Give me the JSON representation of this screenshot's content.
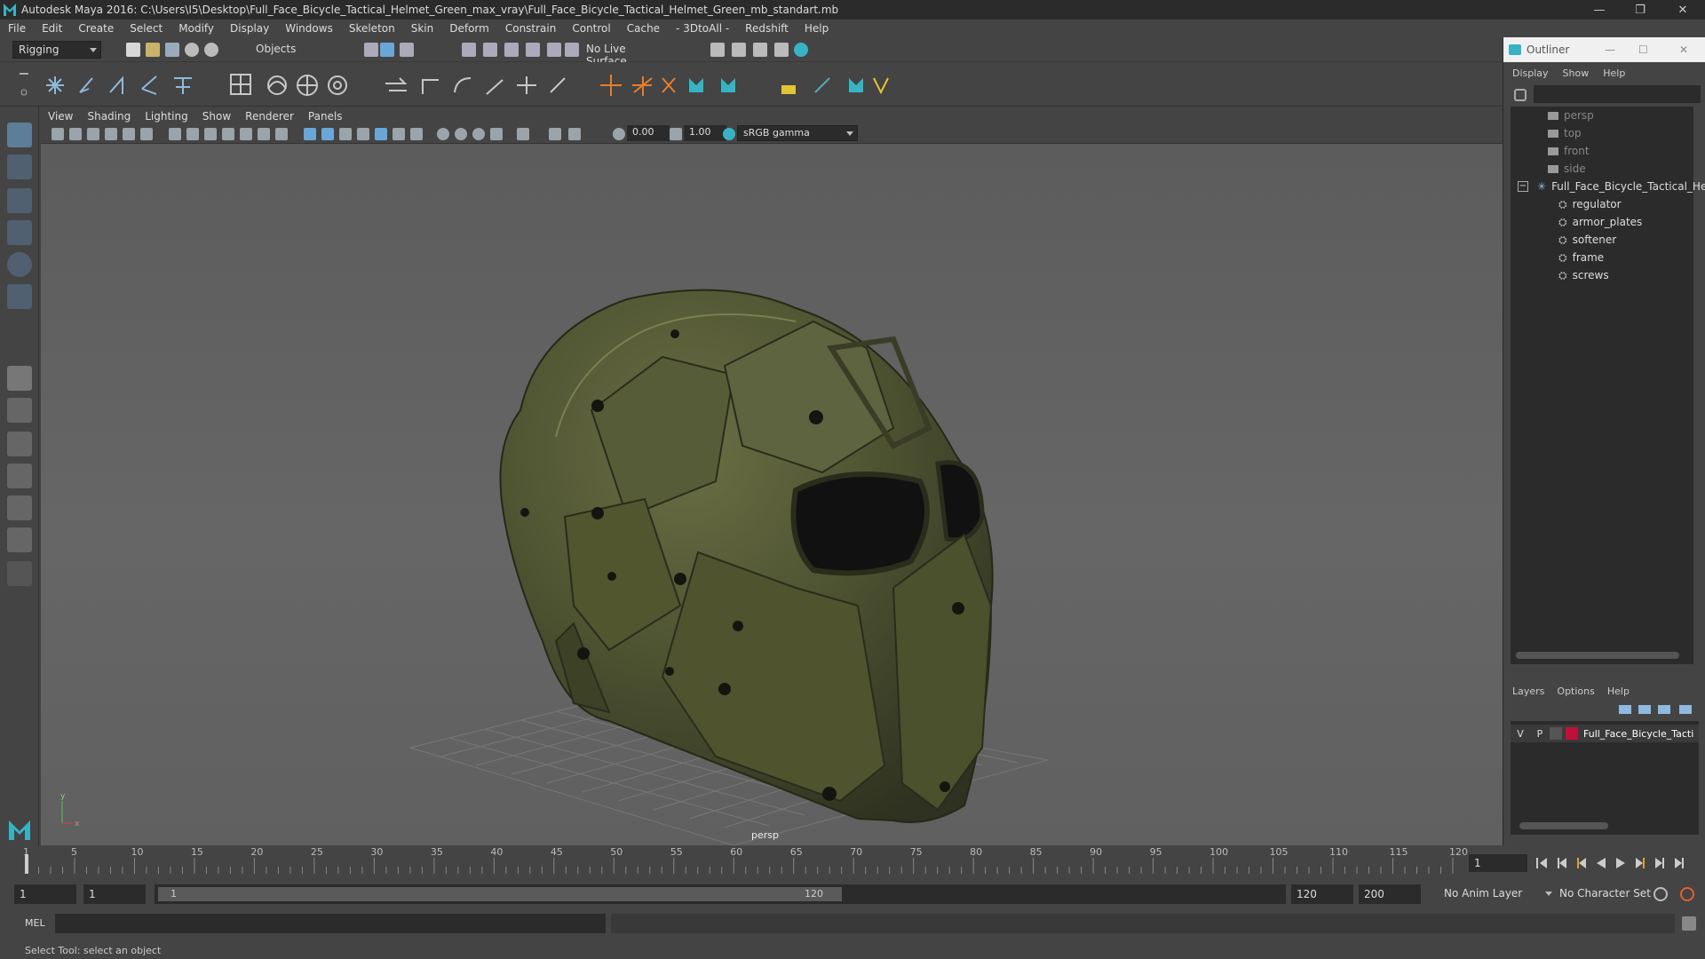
{
  "window": {
    "title": "Autodesk Maya 2016: C:\\Users\\I5\\Desktop\\Full_Face_Bicycle_Tactical_Helmet_Green_max_vray\\Full_Face_Bicycle_Tactical_Helmet_Green_mb_standart.mb",
    "minimize": "—",
    "maximize": "❐",
    "close": "✕"
  },
  "menus": [
    "File",
    "Edit",
    "Create",
    "Select",
    "Modify",
    "Display",
    "Windows",
    "Skeleton",
    "Skin",
    "Deform",
    "Constrain",
    "Control",
    "Cache",
    "- 3DtoAll -",
    "Redshift",
    "Help"
  ],
  "statusline": {
    "menuset": "Rigging",
    "selection_mode": "Objects",
    "live_surface": "No Live Surface"
  },
  "viewport": {
    "menus": [
      "View",
      "Shading",
      "Lighting",
      "Show",
      "Renderer",
      "Panels"
    ],
    "exposure": "0.00",
    "gamma": "1.00",
    "colorspace": "sRGB gamma",
    "camera_label": "persp",
    "axis_y": "y",
    "axis_x": "x"
  },
  "outliner": {
    "title": "Outliner",
    "menus": [
      "Display",
      "Show",
      "Help"
    ],
    "cameras": [
      "persp",
      "top",
      "front",
      "side"
    ],
    "root": "Full_Face_Bicycle_Tactical_He",
    "children": [
      "regulator",
      "armor_plates",
      "softener",
      "frame",
      "screws"
    ]
  },
  "layers": {
    "menus": [
      "Layers",
      "Options",
      "Help"
    ],
    "visible": "V",
    "playback": "P",
    "layer_name": "Full_Face_Bicycle_Tacti",
    "layer_color": "#c0103a"
  },
  "timeline": {
    "ticks": [
      "1",
      "5",
      "10",
      "15",
      "20",
      "25",
      "30",
      "35",
      "40",
      "45",
      "50",
      "55",
      "60",
      "65",
      "70",
      "75",
      "80",
      "85",
      "90",
      "95",
      "100",
      "105",
      "110",
      "115",
      "120"
    ],
    "current_frame": "1",
    "range_start": "1",
    "range_inner_start": "1",
    "slider_start": "1",
    "slider_end": "120",
    "range_end": "120",
    "anim_end": "200",
    "anim_layer": "No Anim Layer",
    "character_set": "No Character Set"
  },
  "command": {
    "label": "MEL"
  },
  "help_line": "Select Tool: select an object",
  "colors": {
    "accent": "#37b3c4",
    "helmet": "#4d5231"
  }
}
